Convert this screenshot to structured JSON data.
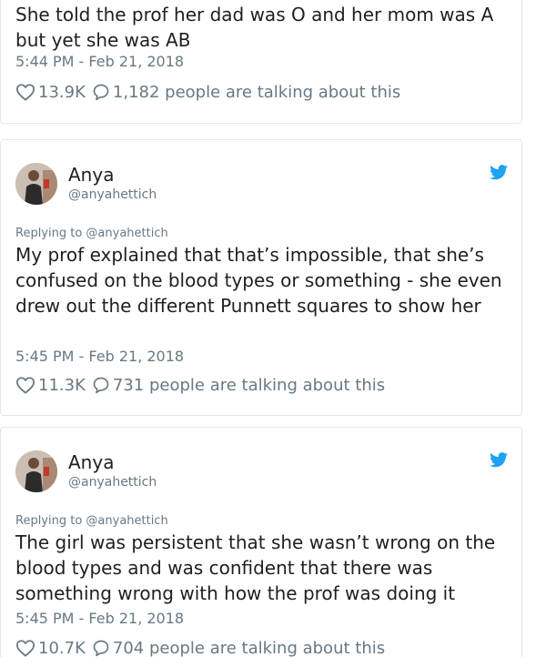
{
  "tweets": [
    {
      "text": "She told the prof her dad was O and her mom was A but yet she was AB",
      "timestamp": "5:44 PM - Feb 21, 2018",
      "likes": "13.9K",
      "talking": "1,182 people are talking about this"
    },
    {
      "author": "Anya",
      "handle": "@anyahettich",
      "replying_to": "Replying to @anyahettich",
      "text": "My prof explained that that’s impossible, that she’s confused on the blood types or something - she even drew out the different Punnett squares to show her",
      "timestamp": "5:45 PM - Feb 21, 2018",
      "likes": "11.3K",
      "talking": "731 people are talking about this"
    },
    {
      "author": "Anya",
      "handle": "@anyahettich",
      "replying_to": "Replying to @anyahettich",
      "text": "The girl was persistent that she wasn’t wrong on the blood types and was confident that there was something wrong with how the prof was doing it",
      "timestamp": "5:45 PM - Feb 21, 2018",
      "likes": "10.7K",
      "talking": "704 people are talking about this"
    }
  ],
  "colors": {
    "text": "#1c2022",
    "muted": "#697882",
    "border": "#e1e8ed",
    "twitter_blue": "#1da1f2"
  },
  "icons": {
    "like": "heart-icon",
    "talk": "speech-bubble-icon",
    "brand": "twitter-bird-icon"
  }
}
